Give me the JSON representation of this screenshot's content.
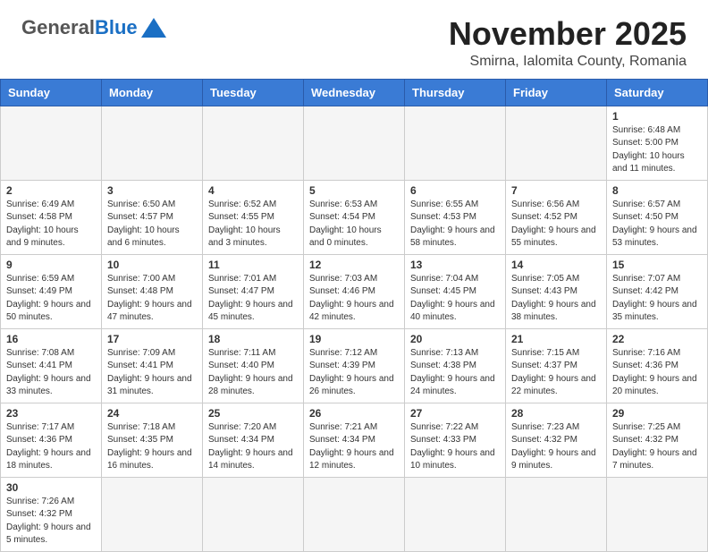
{
  "header": {
    "logo": {
      "general": "General",
      "blue": "Blue",
      "subtitle": ""
    },
    "title": "November 2025",
    "subtitle": "Smirna, Ialomita County, Romania"
  },
  "columns": [
    "Sunday",
    "Monday",
    "Tuesday",
    "Wednesday",
    "Thursday",
    "Friday",
    "Saturday"
  ],
  "weeks": [
    [
      {
        "day": "",
        "info": "",
        "empty": true
      },
      {
        "day": "",
        "info": "",
        "empty": true
      },
      {
        "day": "",
        "info": "",
        "empty": true
      },
      {
        "day": "",
        "info": "",
        "empty": true
      },
      {
        "day": "",
        "info": "",
        "empty": true
      },
      {
        "day": "",
        "info": "",
        "empty": true
      },
      {
        "day": "1",
        "info": "Sunrise: 6:48 AM\nSunset: 5:00 PM\nDaylight: 10 hours and 11 minutes.",
        "empty": false
      }
    ],
    [
      {
        "day": "2",
        "info": "Sunrise: 6:49 AM\nSunset: 4:58 PM\nDaylight: 10 hours and 9 minutes.",
        "empty": false
      },
      {
        "day": "3",
        "info": "Sunrise: 6:50 AM\nSunset: 4:57 PM\nDaylight: 10 hours and 6 minutes.",
        "empty": false
      },
      {
        "day": "4",
        "info": "Sunrise: 6:52 AM\nSunset: 4:55 PM\nDaylight: 10 hours and 3 minutes.",
        "empty": false
      },
      {
        "day": "5",
        "info": "Sunrise: 6:53 AM\nSunset: 4:54 PM\nDaylight: 10 hours and 0 minutes.",
        "empty": false
      },
      {
        "day": "6",
        "info": "Sunrise: 6:55 AM\nSunset: 4:53 PM\nDaylight: 9 hours and 58 minutes.",
        "empty": false
      },
      {
        "day": "7",
        "info": "Sunrise: 6:56 AM\nSunset: 4:52 PM\nDaylight: 9 hours and 55 minutes.",
        "empty": false
      },
      {
        "day": "8",
        "info": "Sunrise: 6:57 AM\nSunset: 4:50 PM\nDaylight: 9 hours and 53 minutes.",
        "empty": false
      }
    ],
    [
      {
        "day": "9",
        "info": "Sunrise: 6:59 AM\nSunset: 4:49 PM\nDaylight: 9 hours and 50 minutes.",
        "empty": false
      },
      {
        "day": "10",
        "info": "Sunrise: 7:00 AM\nSunset: 4:48 PM\nDaylight: 9 hours and 47 minutes.",
        "empty": false
      },
      {
        "day": "11",
        "info": "Sunrise: 7:01 AM\nSunset: 4:47 PM\nDaylight: 9 hours and 45 minutes.",
        "empty": false
      },
      {
        "day": "12",
        "info": "Sunrise: 7:03 AM\nSunset: 4:46 PM\nDaylight: 9 hours and 42 minutes.",
        "empty": false
      },
      {
        "day": "13",
        "info": "Sunrise: 7:04 AM\nSunset: 4:45 PM\nDaylight: 9 hours and 40 minutes.",
        "empty": false
      },
      {
        "day": "14",
        "info": "Sunrise: 7:05 AM\nSunset: 4:43 PM\nDaylight: 9 hours and 38 minutes.",
        "empty": false
      },
      {
        "day": "15",
        "info": "Sunrise: 7:07 AM\nSunset: 4:42 PM\nDaylight: 9 hours and 35 minutes.",
        "empty": false
      }
    ],
    [
      {
        "day": "16",
        "info": "Sunrise: 7:08 AM\nSunset: 4:41 PM\nDaylight: 9 hours and 33 minutes.",
        "empty": false
      },
      {
        "day": "17",
        "info": "Sunrise: 7:09 AM\nSunset: 4:41 PM\nDaylight: 9 hours and 31 minutes.",
        "empty": false
      },
      {
        "day": "18",
        "info": "Sunrise: 7:11 AM\nSunset: 4:40 PM\nDaylight: 9 hours and 28 minutes.",
        "empty": false
      },
      {
        "day": "19",
        "info": "Sunrise: 7:12 AM\nSunset: 4:39 PM\nDaylight: 9 hours and 26 minutes.",
        "empty": false
      },
      {
        "day": "20",
        "info": "Sunrise: 7:13 AM\nSunset: 4:38 PM\nDaylight: 9 hours and 24 minutes.",
        "empty": false
      },
      {
        "day": "21",
        "info": "Sunrise: 7:15 AM\nSunset: 4:37 PM\nDaylight: 9 hours and 22 minutes.",
        "empty": false
      },
      {
        "day": "22",
        "info": "Sunrise: 7:16 AM\nSunset: 4:36 PM\nDaylight: 9 hours and 20 minutes.",
        "empty": false
      }
    ],
    [
      {
        "day": "23",
        "info": "Sunrise: 7:17 AM\nSunset: 4:36 PM\nDaylight: 9 hours and 18 minutes.",
        "empty": false
      },
      {
        "day": "24",
        "info": "Sunrise: 7:18 AM\nSunset: 4:35 PM\nDaylight: 9 hours and 16 minutes.",
        "empty": false
      },
      {
        "day": "25",
        "info": "Sunrise: 7:20 AM\nSunset: 4:34 PM\nDaylight: 9 hours and 14 minutes.",
        "empty": false
      },
      {
        "day": "26",
        "info": "Sunrise: 7:21 AM\nSunset: 4:34 PM\nDaylight: 9 hours and 12 minutes.",
        "empty": false
      },
      {
        "day": "27",
        "info": "Sunrise: 7:22 AM\nSunset: 4:33 PM\nDaylight: 9 hours and 10 minutes.",
        "empty": false
      },
      {
        "day": "28",
        "info": "Sunrise: 7:23 AM\nSunset: 4:32 PM\nDaylight: 9 hours and 9 minutes.",
        "empty": false
      },
      {
        "day": "29",
        "info": "Sunrise: 7:25 AM\nSunset: 4:32 PM\nDaylight: 9 hours and 7 minutes.",
        "empty": false
      }
    ],
    [
      {
        "day": "30",
        "info": "Sunrise: 7:26 AM\nSunset: 4:32 PM\nDaylight: 9 hours and 5 minutes.",
        "empty": false
      },
      {
        "day": "",
        "info": "",
        "empty": true
      },
      {
        "day": "",
        "info": "",
        "empty": true
      },
      {
        "day": "",
        "info": "",
        "empty": true
      },
      {
        "day": "",
        "info": "",
        "empty": true
      },
      {
        "day": "",
        "info": "",
        "empty": true
      },
      {
        "day": "",
        "info": "",
        "empty": true
      }
    ]
  ]
}
